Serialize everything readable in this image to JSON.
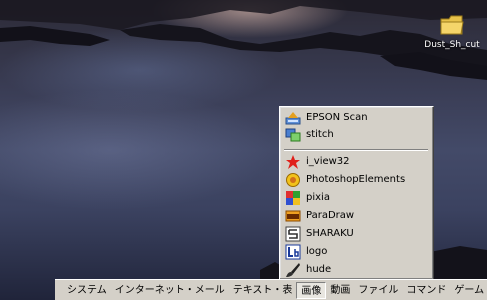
{
  "desktop": {
    "icons": [
      {
        "label": "Dust_Sh_cut",
        "icon": "folder-icon"
      }
    ]
  },
  "popup_menu": {
    "groups": [
      [
        {
          "label": "EPSON Scan",
          "icon": "epson-scan-icon"
        },
        {
          "label": "stitch",
          "icon": "stitch-icon"
        }
      ],
      [
        {
          "label": "i_view32",
          "icon": "irfanview-icon"
        },
        {
          "label": "PhotoshopElements",
          "icon": "photoshop-elements-icon"
        },
        {
          "label": "pixia",
          "icon": "pixia-icon"
        },
        {
          "label": "ParaDraw",
          "icon": "paradraw-icon"
        },
        {
          "label": "SHARAKU",
          "icon": "sharaku-icon"
        },
        {
          "label": "logo",
          "icon": "logo-app-icon"
        },
        {
          "label": "hude",
          "icon": "brush-icon"
        }
      ]
    ]
  },
  "taskbar": {
    "start_icon": "launcher-icon",
    "items": [
      {
        "label": "システム",
        "active": false
      },
      {
        "label": "インターネット・メール",
        "active": false
      },
      {
        "label": "テキスト・表",
        "active": false
      },
      {
        "label": "画像",
        "active": true
      },
      {
        "label": "動画",
        "active": false
      },
      {
        "label": "ファイル",
        "active": false
      },
      {
        "label": "コマンド",
        "active": false
      },
      {
        "label": "ゲーム",
        "active": false
      }
    ]
  }
}
